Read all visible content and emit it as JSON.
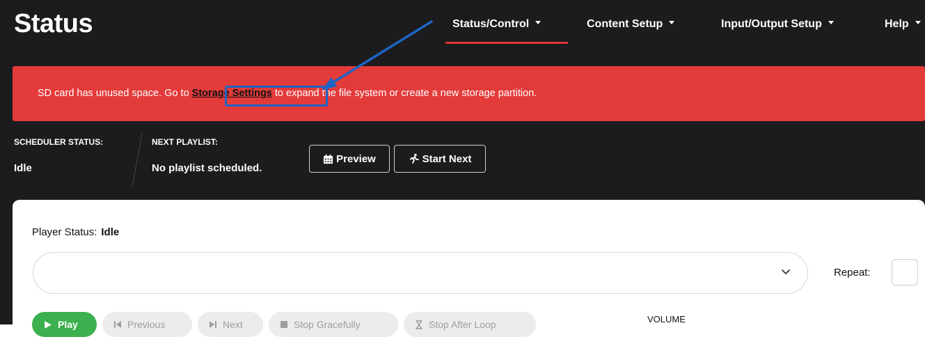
{
  "header": {
    "title": "Status",
    "nav": [
      {
        "label": "Status/Control",
        "active": true
      },
      {
        "label": "Content Setup",
        "active": false
      },
      {
        "label": "Input/Output Setup",
        "active": false
      },
      {
        "label": "Help",
        "active": false
      }
    ]
  },
  "alert": {
    "text_before": "SD card has unused space. Go to ",
    "link": "Storage Settings",
    "text_after": " to expand the file system or create a new storage partition."
  },
  "scheduler": {
    "status_label": "SCHEDULER STATUS:",
    "status_value": "Idle",
    "next_label": "NEXT PLAYLIST:",
    "next_value": "No playlist scheduled.",
    "preview_label": "Preview",
    "start_next_label": "Start Next"
  },
  "player": {
    "status_label": "Player Status:",
    "status_value": "Idle",
    "playlist_selected": "",
    "repeat_label": "Repeat:",
    "buttons": {
      "play": "Play",
      "previous": "Previous",
      "next": "Next",
      "stop_gracefully": "Stop Gracefully",
      "stop_after_loop": "Stop After Loop"
    },
    "volume_label": "VOLUME"
  },
  "colors": {
    "background": "#1c1c1e",
    "alert": "#e33a3a",
    "nav_active_underline": "#e0333a",
    "annotation": "#1d65c4",
    "play": "#3cb04e"
  },
  "icons": [
    "chevron-down-icon",
    "calendar-icon",
    "running-person-icon",
    "play-icon",
    "skip-previous-icon",
    "skip-next-icon",
    "stop-icon",
    "hourglass-icon",
    "annotation-arrow-icon"
  ]
}
